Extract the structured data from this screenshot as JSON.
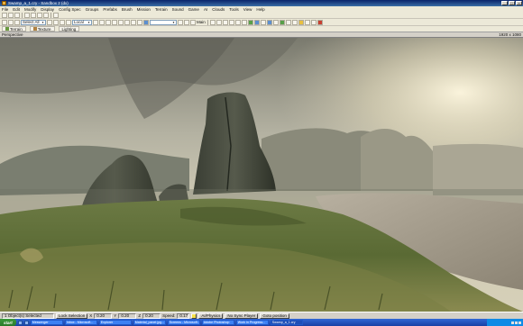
{
  "window": {
    "title": "Swamp_a_1.cry - Sandbox 2 (dx)"
  },
  "menu": [
    "File",
    "Edit",
    "Modify",
    "Display",
    "Config Spec",
    "Groups",
    "Prefabs",
    "Brush",
    "Mission",
    "Terrain",
    "Sound",
    "Game",
    "AI",
    "Clouds",
    "Tools",
    "View",
    "Help"
  ],
  "toolbar": {
    "select_mode": "Select All",
    "coord_space": "Local",
    "layer": "",
    "main_label": "Main"
  },
  "tabs": [
    {
      "label": "Terrain",
      "icon": "terrain-icon"
    },
    {
      "label": "Texture",
      "icon": "texture-icon"
    },
    {
      "label": "Lighting",
      "icon": "lighting-icon"
    }
  ],
  "viewport": {
    "label": "Perspective",
    "resolution": "1920 x 1080"
  },
  "status": {
    "selection": "1 Object(s) Selected",
    "lock_selection": "Lock Selection",
    "x_label": "X",
    "x_value": "0.20",
    "y_label": "Y",
    "y_value": "0.20",
    "z_label": "Z",
    "z_value": "0.20",
    "speed_label": "Speed:",
    "speed_value": "0.17",
    "ai_physics": "AI/Physics",
    "no_sync_player": "No Sync Player",
    "goto_position": "Goto position"
  },
  "taskbar": {
    "start": "start",
    "tasks": [
      "Messenger",
      "Inbox - Microsoft...",
      "Explorer",
      "Material_panel.jpg...",
      "Screens - Microsoft...",
      "Adobe Photoshop",
      "Work in Progress...",
      "Swamp_a_1.cry"
    ],
    "active_task": 7
  }
}
